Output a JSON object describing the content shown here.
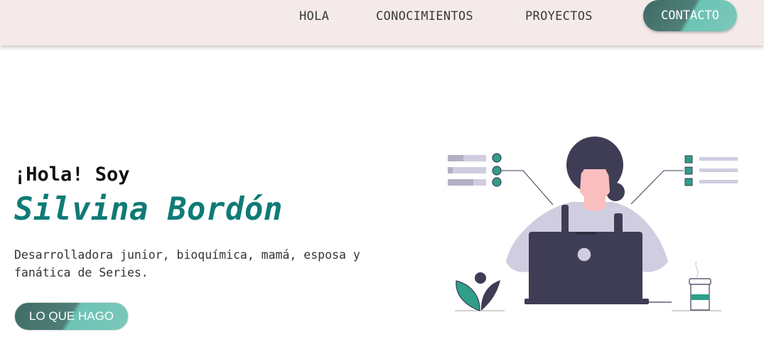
{
  "nav": {
    "links": [
      {
        "label": "HOLA"
      },
      {
        "label": "CONOCIMIENTOS"
      },
      {
        "label": "PROYECTOS"
      }
    ],
    "contact_label": "CONTACTO"
  },
  "hero": {
    "greeting": "¡Hola! Soy",
    "name": "Silvina Bordón",
    "description": "Desarrolladora junior, bioquímica, mamá, esposa y fanática de Series.",
    "cta_label": "LO QUE HAGO"
  },
  "colors": {
    "nav_background": "#f4eae9",
    "accent_teal": "#0f7b76",
    "button_dark": "#4f7f78",
    "button_light": "#6cc3b4",
    "illustration_dark": "#3f3d56",
    "illustration_light": "#d0cde1",
    "illustration_green": "#2f9e8a"
  },
  "illustration": {
    "icon": "woman-working-on-laptop-illustration"
  }
}
